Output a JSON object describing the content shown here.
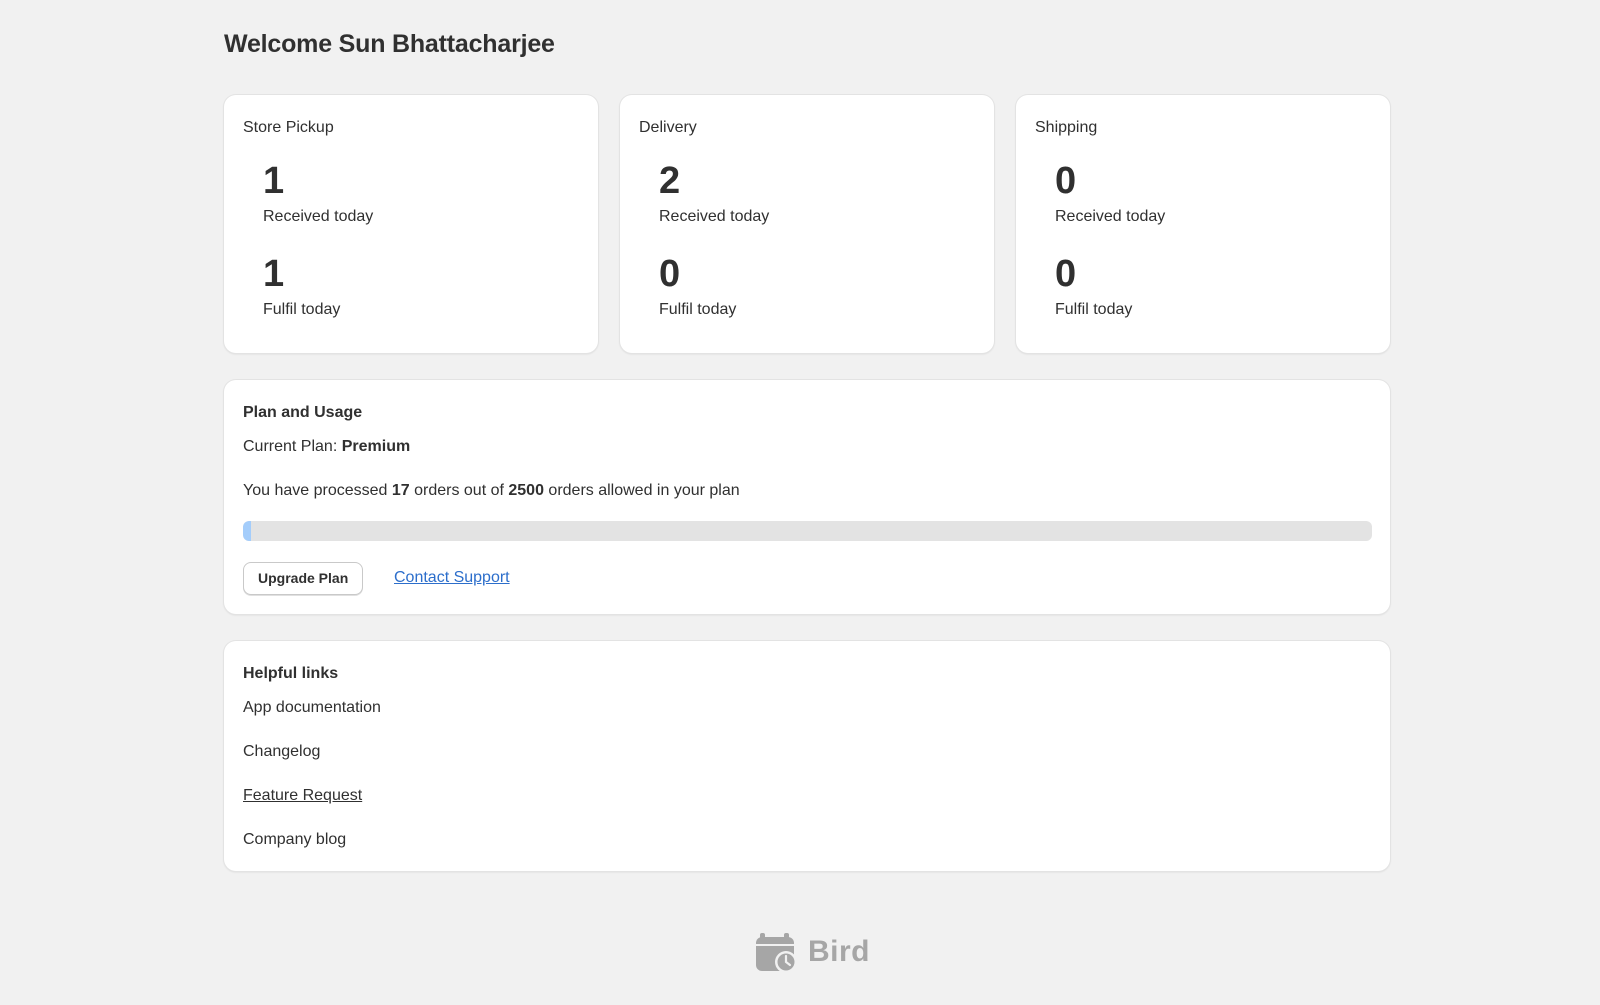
{
  "header": {
    "welcome": "Welcome Sun Bhattacharjee"
  },
  "stats": [
    {
      "title": "Store Pickup",
      "received_value": "1",
      "received_label": "Received today",
      "fulfil_value": "1",
      "fulfil_label": "Fulfil today"
    },
    {
      "title": "Delivery",
      "received_value": "2",
      "received_label": "Received today",
      "fulfil_value": "0",
      "fulfil_label": "Fulfil today"
    },
    {
      "title": "Shipping",
      "received_value": "0",
      "received_label": "Received today",
      "fulfil_value": "0",
      "fulfil_label": "Fulfil today"
    }
  ],
  "plan": {
    "title": "Plan and Usage",
    "current_plan_label": "Current Plan: ",
    "current_plan_value": "Premium",
    "processed_prefix": "You have processed ",
    "processed_count": "17",
    "processed_middle": " orders out of ",
    "allowed_count": "2500",
    "processed_suffix": " orders allowed in your plan",
    "progress_fraction": 0.0068,
    "progress_color": "#a4cdfb",
    "upgrade_label": "Upgrade Plan",
    "support_label": "Contact Support"
  },
  "helpful_links": {
    "title": "Helpful links",
    "items": [
      {
        "label": "App documentation"
      },
      {
        "label": "Changelog"
      },
      {
        "label": "Feature Request"
      },
      {
        "label": "Company blog"
      }
    ]
  },
  "footer": {
    "logo_icon": "calendar-clock-icon",
    "logo_text": "Bird",
    "logo_color": "#a6a6a6"
  }
}
